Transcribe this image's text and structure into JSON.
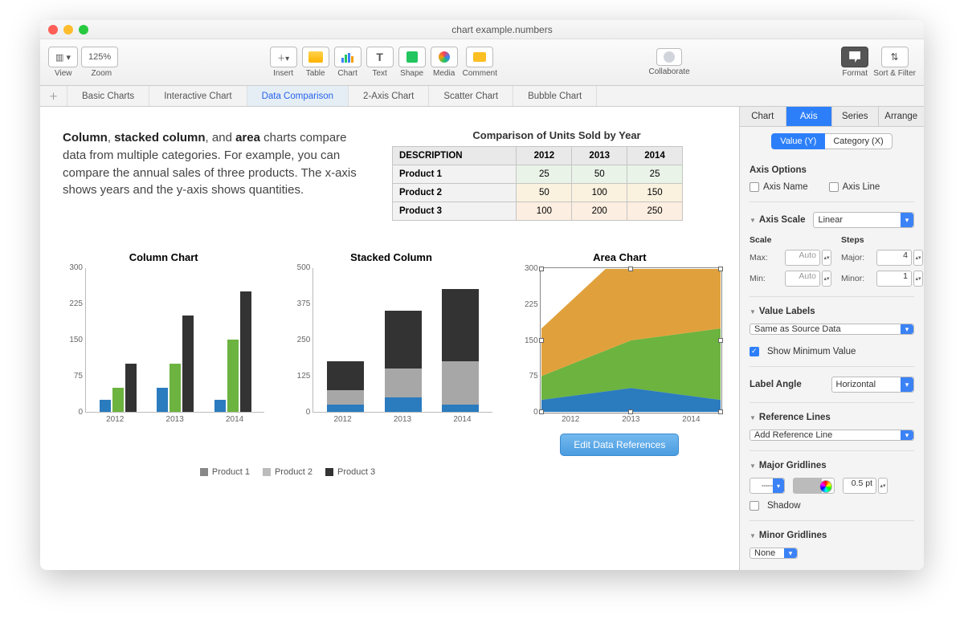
{
  "window": {
    "title": "chart example.numbers"
  },
  "toolbar": {
    "zoom": "125%",
    "view_label": "View",
    "zoom_label": "Zoom",
    "insert_label": "Insert",
    "table_label": "Table",
    "chart_label": "Chart",
    "text_label": "Text",
    "shape_label": "Shape",
    "media_label": "Media",
    "comment_label": "Comment",
    "collaborate_label": "Collaborate",
    "format_label": "Format",
    "sort_label": "Sort & Filter"
  },
  "sheets": {
    "items": [
      "Basic Charts",
      "Interactive Chart",
      "Data Comparison",
      "2-Axis Chart",
      "Scatter Chart",
      "Bubble Chart"
    ],
    "active": 2
  },
  "intro": {
    "html": "<b>Column</b>, <b>stacked column</b>, and <b>area</b> charts compare data from multiple categories. For example, you can compare the annual sales of three products. The x-axis shows years and the y-axis shows quantities."
  },
  "table": {
    "title": "Comparison of Units Sold by Year",
    "header": [
      "DESCRIPTION",
      "2012",
      "2013",
      "2014"
    ],
    "rows": [
      [
        "Product 1",
        "25",
        "50",
        "25"
      ],
      [
        "Product 2",
        "50",
        "100",
        "150"
      ],
      [
        "Product 3",
        "100",
        "200",
        "250"
      ]
    ]
  },
  "chart_data": [
    {
      "type": "bar",
      "title": "Column Chart",
      "categories": [
        "2012",
        "2013",
        "2014"
      ],
      "series": [
        {
          "name": "Product 1",
          "values": [
            25,
            50,
            25
          ]
        },
        {
          "name": "Product 2",
          "values": [
            50,
            100,
            150
          ]
        },
        {
          "name": "Product 3",
          "values": [
            100,
            200,
            250
          ]
        }
      ],
      "ylim": [
        0,
        300
      ],
      "yticks": [
        0,
        75,
        150,
        225,
        300
      ]
    },
    {
      "type": "bar-stacked",
      "title": "Stacked Column",
      "categories": [
        "2012",
        "2013",
        "2014"
      ],
      "series": [
        {
          "name": "Product 1",
          "values": [
            25,
            50,
            25
          ]
        },
        {
          "name": "Product 2",
          "values": [
            50,
            100,
            150
          ]
        },
        {
          "name": "Product 3",
          "values": [
            100,
            200,
            250
          ]
        }
      ],
      "ylim": [
        0,
        500
      ],
      "yticks": [
        0,
        125,
        250,
        375,
        500
      ]
    },
    {
      "type": "area",
      "title": "Area Chart",
      "categories": [
        "2012",
        "2013",
        "2014"
      ],
      "series": [
        {
          "name": "Product 1",
          "values": [
            25,
            50,
            25
          ]
        },
        {
          "name": "Product 2",
          "values": [
            50,
            100,
            150
          ]
        },
        {
          "name": "Product 3",
          "values": [
            100,
            200,
            250
          ]
        }
      ],
      "ylim": [
        0,
        300
      ],
      "yticks": [
        0,
        75,
        150,
        225,
        300
      ]
    }
  ],
  "legend": {
    "items": [
      "Product 1",
      "Product 2",
      "Product 3"
    ]
  },
  "edit_btn": "Edit Data References",
  "inspector": {
    "top_tabs": [
      "Chart",
      "Axis",
      "Series",
      "Arrange"
    ],
    "top_active": 1,
    "axis_tabs": [
      "Value (Y)",
      "Category (X)"
    ],
    "axis_active": 0,
    "axis_options": "Axis Options",
    "axis_name": "Axis Name",
    "axis_line": "Axis Line",
    "axis_scale_label": "Axis Scale",
    "axis_scale_value": "Linear",
    "scale_label": "Scale",
    "steps_label": "Steps",
    "max_label": "Max:",
    "min_label": "Min:",
    "auto": "Auto",
    "major_label": "Major:",
    "minor_label": "Minor:",
    "major_val": "4",
    "minor_val": "1",
    "value_labels": "Value Labels",
    "value_labels_value": "Same as Source Data",
    "show_min": "Show Minimum Value",
    "label_angle": "Label Angle",
    "label_angle_value": "Horizontal",
    "ref_lines": "Reference Lines",
    "add_ref": "Add Reference Line",
    "major_grid": "Major Gridlines",
    "grid_pt": "0.5 pt",
    "shadow": "Shadow",
    "minor_grid": "Minor Gridlines",
    "minor_grid_value": "None"
  }
}
